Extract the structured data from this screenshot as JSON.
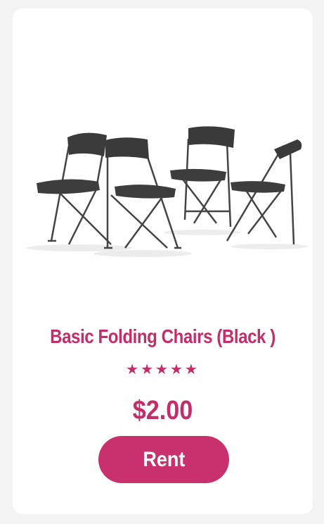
{
  "product": {
    "title": "Basic Folding Chairs (Black )",
    "rating_stars": "★★★★★",
    "rating": 5,
    "price": "$2.00",
    "rent_label": "Rent",
    "image_icon": "folding-chairs-image"
  },
  "colors": {
    "accent": "#c22d6a",
    "button": "#c8316d",
    "card": "#ffffff",
    "page": "#f3f3f3",
    "chair": "#3a3a3a"
  }
}
